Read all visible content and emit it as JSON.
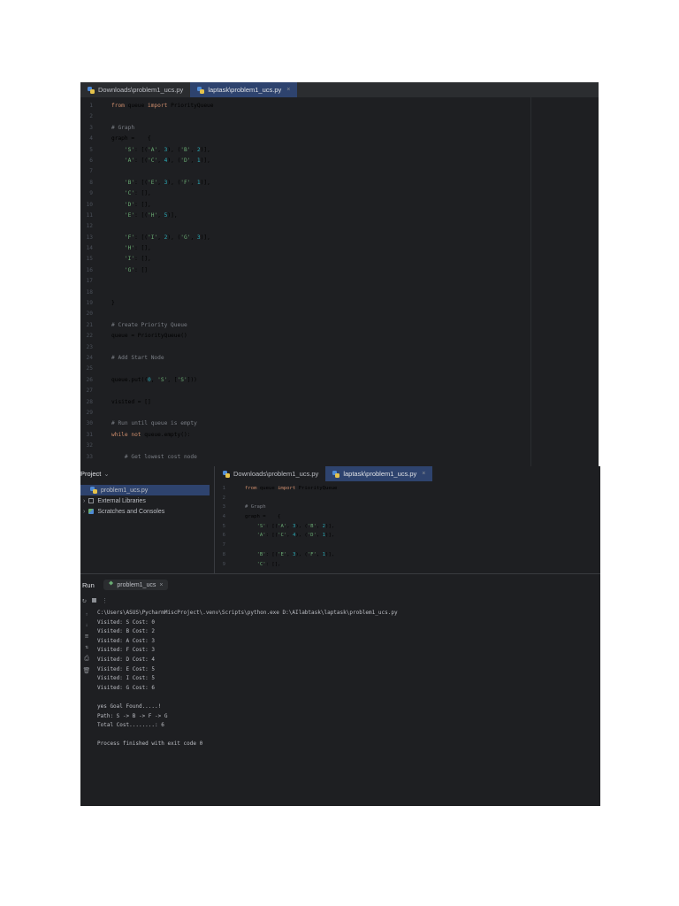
{
  "top_editor": {
    "tabs": [
      {
        "label": "Downloads\\problem1_ucs.py",
        "active": false
      },
      {
        "label": "laptask\\problem1_ucs.py",
        "active": true,
        "close": "×"
      }
    ],
    "lines": [
      {
        "n": "1",
        "tokens": [
          {
            "t": "from",
            "c": "kw"
          },
          {
            "t": " queue ",
            "c": ""
          },
          {
            "t": "import",
            "c": "kw"
          },
          {
            "t": " PriorityQueue",
            "c": ""
          }
        ]
      },
      {
        "n": "2",
        "tokens": []
      },
      {
        "n": "3",
        "tokens": [
          {
            "t": "# Graph",
            "c": "cmt"
          }
        ]
      },
      {
        "n": "4",
        "tokens": [
          {
            "t": "graph =    {",
            "c": ""
          }
        ]
      },
      {
        "n": "5",
        "tokens": [
          {
            "t": "    ",
            "c": ""
          },
          {
            "t": "'S'",
            "c": "str"
          },
          {
            "t": ": [(",
            "c": ""
          },
          {
            "t": "'A'",
            "c": "str"
          },
          {
            "t": ", ",
            "c": ""
          },
          {
            "t": "3",
            "c": "num"
          },
          {
            "t": "), (",
            "c": ""
          },
          {
            "t": "'B'",
            "c": "str"
          },
          {
            "t": ", ",
            "c": ""
          },
          {
            "t": "2",
            "c": "num"
          },
          {
            "t": ")],",
            "c": ""
          }
        ]
      },
      {
        "n": "6",
        "tokens": [
          {
            "t": "    ",
            "c": ""
          },
          {
            "t": "'A'",
            "c": "str"
          },
          {
            "t": ": [(",
            "c": ""
          },
          {
            "t": "'C'",
            "c": "str"
          },
          {
            "t": ", ",
            "c": ""
          },
          {
            "t": "4",
            "c": "num"
          },
          {
            "t": "), (",
            "c": ""
          },
          {
            "t": "'D'",
            "c": "str"
          },
          {
            "t": ", ",
            "c": ""
          },
          {
            "t": "1",
            "c": "num"
          },
          {
            "t": ")],",
            "c": ""
          }
        ]
      },
      {
        "n": "7",
        "tokens": []
      },
      {
        "n": "8",
        "tokens": [
          {
            "t": "    ",
            "c": ""
          },
          {
            "t": "'B'",
            "c": "str"
          },
          {
            "t": ": [(",
            "c": ""
          },
          {
            "t": "'E'",
            "c": "str"
          },
          {
            "t": ", ",
            "c": ""
          },
          {
            "t": "3",
            "c": "num"
          },
          {
            "t": "), (",
            "c": ""
          },
          {
            "t": "'F'",
            "c": "str"
          },
          {
            "t": ", ",
            "c": ""
          },
          {
            "t": "1",
            "c": "num"
          },
          {
            "t": ")],",
            "c": ""
          }
        ]
      },
      {
        "n": "9",
        "tokens": [
          {
            "t": "    ",
            "c": ""
          },
          {
            "t": "'C'",
            "c": "str"
          },
          {
            "t": ": [],",
            "c": ""
          }
        ]
      },
      {
        "n": "10",
        "tokens": [
          {
            "t": "    ",
            "c": ""
          },
          {
            "t": "'D'",
            "c": "str"
          },
          {
            "t": ": [],",
            "c": ""
          }
        ]
      },
      {
        "n": "11",
        "tokens": [
          {
            "t": "    ",
            "c": ""
          },
          {
            "t": "'E'",
            "c": "str"
          },
          {
            "t": ": [(",
            "c": ""
          },
          {
            "t": "'H'",
            "c": "str"
          },
          {
            "t": ", ",
            "c": ""
          },
          {
            "t": "5",
            "c": "num"
          },
          {
            "t": ")],",
            "c": ""
          }
        ]
      },
      {
        "n": "12",
        "tokens": []
      },
      {
        "n": "13",
        "tokens": [
          {
            "t": "    ",
            "c": ""
          },
          {
            "t": "'F'",
            "c": "str"
          },
          {
            "t": ": [(",
            "c": ""
          },
          {
            "t": "'I'",
            "c": "str"
          },
          {
            "t": ", ",
            "c": ""
          },
          {
            "t": "2",
            "c": "num"
          },
          {
            "t": "), (",
            "c": ""
          },
          {
            "t": "'G'",
            "c": "str"
          },
          {
            "t": ", ",
            "c": ""
          },
          {
            "t": "3",
            "c": "num"
          },
          {
            "t": ")],",
            "c": ""
          }
        ]
      },
      {
        "n": "14",
        "tokens": [
          {
            "t": "    ",
            "c": ""
          },
          {
            "t": "'H'",
            "c": "str"
          },
          {
            "t": ": [],",
            "c": ""
          }
        ]
      },
      {
        "n": "15",
        "tokens": [
          {
            "t": "    ",
            "c": ""
          },
          {
            "t": "'I'",
            "c": "str"
          },
          {
            "t": ": [],",
            "c": ""
          }
        ]
      },
      {
        "n": "16",
        "tokens": [
          {
            "t": "    ",
            "c": ""
          },
          {
            "t": "'G'",
            "c": "str"
          },
          {
            "t": ": []",
            "c": ""
          }
        ]
      },
      {
        "n": "17",
        "tokens": []
      },
      {
        "n": "18",
        "tokens": []
      },
      {
        "n": "19",
        "tokens": [
          {
            "t": "}",
            "c": ""
          }
        ]
      },
      {
        "n": "20",
        "tokens": []
      },
      {
        "n": "21",
        "tokens": [
          {
            "t": "# Create Priority Queue",
            "c": "cmt"
          }
        ]
      },
      {
        "n": "22",
        "tokens": [
          {
            "t": "queue = PriorityQueue()",
            "c": ""
          }
        ]
      },
      {
        "n": "23",
        "tokens": []
      },
      {
        "n": "24",
        "tokens": [
          {
            "t": "# Add Start Node",
            "c": "cmt"
          }
        ]
      },
      {
        "n": "25",
        "tokens": []
      },
      {
        "n": "26",
        "tokens": [
          {
            "t": "queue.put((",
            "c": ""
          },
          {
            "t": "0",
            "c": "num"
          },
          {
            "t": ", ",
            "c": ""
          },
          {
            "t": "'S'",
            "c": "str"
          },
          {
            "t": ", [",
            "c": ""
          },
          {
            "t": "'S'",
            "c": "str"
          },
          {
            "t": "]))",
            "c": ""
          }
        ]
      },
      {
        "n": "27",
        "tokens": []
      },
      {
        "n": "28",
        "tokens": [
          {
            "t": "visited = []",
            "c": ""
          }
        ]
      },
      {
        "n": "29",
        "tokens": []
      },
      {
        "n": "30",
        "tokens": [
          {
            "t": "# Run until queue is empty",
            "c": "cmt"
          }
        ]
      },
      {
        "n": "31",
        "tokens": [
          {
            "t": "while not",
            "c": "kw"
          },
          {
            "t": " queue.empty():",
            "c": ""
          }
        ]
      },
      {
        "n": "32",
        "tokens": []
      },
      {
        "n": "33",
        "tokens": [
          {
            "t": "    # Get lowest cost node",
            "c": "cmt"
          }
        ]
      }
    ]
  },
  "project_panel": {
    "title": "Project",
    "chevron": "⌄",
    "items": [
      {
        "label": "problem1_ucs.py",
        "icon": "python-file-icon",
        "selected": true
      },
      {
        "label": "External Libraries",
        "icon": "library-icon",
        "arrow": "›"
      },
      {
        "label": "Scratches and Consoles",
        "icon": "scratches-icon",
        "arrow": "›"
      }
    ]
  },
  "mini_editor": {
    "tabs": [
      {
        "label": "Downloads\\problem1_ucs.py",
        "active": false
      },
      {
        "label": "laptask\\problem1_ucs.py",
        "active": true,
        "close": "×"
      }
    ],
    "lines": [
      {
        "n": "1",
        "tokens": [
          {
            "t": "from",
            "c": "kw"
          },
          {
            "t": " queue ",
            "c": ""
          },
          {
            "t": "import",
            "c": "kw"
          },
          {
            "t": " PriorityQueue",
            "c": ""
          }
        ]
      },
      {
        "n": "2",
        "tokens": []
      },
      {
        "n": "3",
        "tokens": [
          {
            "t": "# Graph",
            "c": "cmt"
          }
        ]
      },
      {
        "n": "4",
        "tokens": [
          {
            "t": "graph =    {",
            "c": ""
          }
        ]
      },
      {
        "n": "5",
        "tokens": [
          {
            "t": "    ",
            "c": ""
          },
          {
            "t": "'S'",
            "c": "str"
          },
          {
            "t": ": [(",
            "c": ""
          },
          {
            "t": "'A'",
            "c": "str"
          },
          {
            "t": ", ",
            "c": ""
          },
          {
            "t": "3",
            "c": "num"
          },
          {
            "t": "), (",
            "c": ""
          },
          {
            "t": "'B'",
            "c": "str"
          },
          {
            "t": ", ",
            "c": ""
          },
          {
            "t": "2",
            "c": "num"
          },
          {
            "t": ")],",
            "c": ""
          }
        ]
      },
      {
        "n": "6",
        "tokens": [
          {
            "t": "    ",
            "c": ""
          },
          {
            "t": "'A'",
            "c": "str"
          },
          {
            "t": ": [(",
            "c": ""
          },
          {
            "t": "'C'",
            "c": "str"
          },
          {
            "t": ", ",
            "c": ""
          },
          {
            "t": "4",
            "c": "num"
          },
          {
            "t": "), (",
            "c": ""
          },
          {
            "t": "'D'",
            "c": "str"
          },
          {
            "t": ", ",
            "c": ""
          },
          {
            "t": "1",
            "c": "num"
          },
          {
            "t": ")],",
            "c": ""
          }
        ]
      },
      {
        "n": "7",
        "tokens": []
      },
      {
        "n": "8",
        "tokens": [
          {
            "t": "    ",
            "c": ""
          },
          {
            "t": "'B'",
            "c": "str"
          },
          {
            "t": ": [(",
            "c": ""
          },
          {
            "t": "'E'",
            "c": "str"
          },
          {
            "t": ", ",
            "c": ""
          },
          {
            "t": "3",
            "c": "num"
          },
          {
            "t": "), (",
            "c": ""
          },
          {
            "t": "'F'",
            "c": "str"
          },
          {
            "t": ", ",
            "c": ""
          },
          {
            "t": "1",
            "c": "num"
          },
          {
            "t": ")],",
            "c": ""
          }
        ]
      },
      {
        "n": "9",
        "tokens": [
          {
            "t": "    ",
            "c": ""
          },
          {
            "t": "'C'",
            "c": "str"
          },
          {
            "t": ": [],",
            "c": ""
          }
        ]
      }
    ]
  },
  "run_panel": {
    "label": "Run",
    "tab": "problem1_ucs",
    "tab_close": "×",
    "toolbar_icons": [
      "rerun-icon",
      "stop-icon",
      "more-icon"
    ],
    "side_icons": [
      "scroll-up-icon",
      "scroll-down-icon",
      "soft-wrap-icon",
      "sort-icon",
      "print-icon",
      "trash-icon"
    ],
    "output": [
      "C:\\Users\\ASUS\\PycharmMiscProject\\.venv\\Scripts\\python.exe D:\\AIlabtask\\laptask\\problem1_ucs.py",
      "Visited: S Cost: 0",
      "Visited: B Cost: 2",
      "Visited: A Cost: 3",
      "Visited: F Cost: 3",
      "Visited: D Cost: 4",
      "Visited: E Cost: 5",
      "Visited: I Cost: 5",
      "Visited: G Cost: 6",
      "",
      "yes Goal Found.....!",
      "Path: S -> B -> F -> G",
      "Total Cost........: 6",
      "",
      "Process finished with exit code 0"
    ]
  },
  "colors": {
    "bg": "#1e1f22",
    "tab_active": "#2e436e",
    "keyword": "#cf8e6d",
    "string": "#6aab73",
    "number": "#2aacb8",
    "comment": "#7a7e85"
  }
}
